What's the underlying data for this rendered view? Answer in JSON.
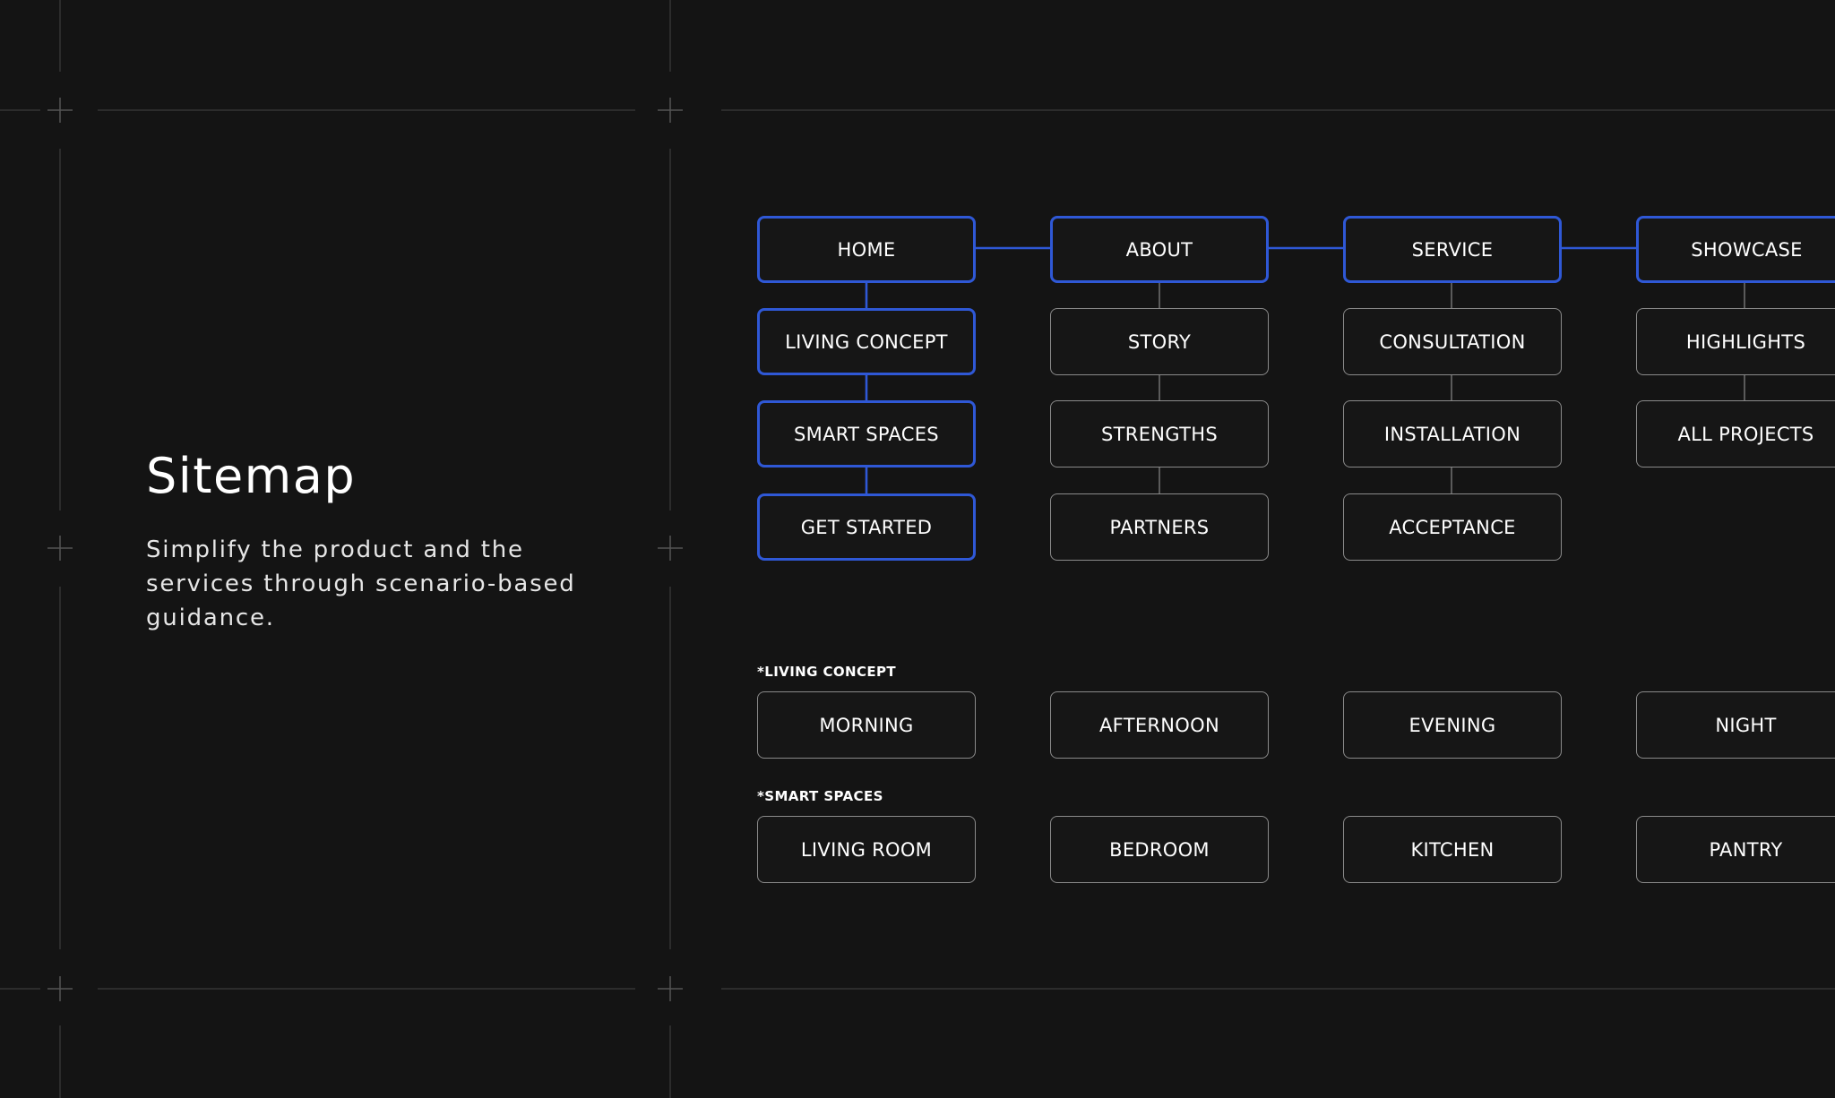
{
  "intro": {
    "title": "Sitemap",
    "description": "Simplify the product and the services through scenario-based guidance."
  },
  "colors": {
    "background": "#141414",
    "highlight": "#2f58d6",
    "node_border": "#8a8a8a",
    "guides": "#3a3a3a"
  },
  "sitemap": {
    "columns": [
      {
        "label": "HOME",
        "highlighted": true,
        "children": [
          {
            "label": "LIVING CONCEPT",
            "highlighted": true
          },
          {
            "label": "SMART SPACES",
            "highlighted": true
          },
          {
            "label": "GET STARTED",
            "highlighted": true
          }
        ]
      },
      {
        "label": "ABOUT",
        "highlighted": true,
        "children": [
          {
            "label": "STORY",
            "highlighted": false
          },
          {
            "label": "STRENGTHS",
            "highlighted": false
          },
          {
            "label": "PARTNERS",
            "highlighted": false
          }
        ]
      },
      {
        "label": "SERVICE",
        "highlighted": true,
        "children": [
          {
            "label": "CONSULTATION",
            "highlighted": false
          },
          {
            "label": "INSTALLATION",
            "highlighted": false
          },
          {
            "label": "ACCEPTANCE",
            "highlighted": false
          }
        ]
      },
      {
        "label": "SHOWCASE",
        "highlighted": true,
        "children": [
          {
            "label": "HIGHLIGHTS",
            "highlighted": false
          },
          {
            "label": "ALL PROJECTS",
            "highlighted": false
          }
        ]
      }
    ]
  },
  "living_concept": {
    "heading": "*LIVING CONCEPT",
    "items": [
      "MORNING",
      "AFTERNOON",
      "EVENING",
      "NIGHT"
    ]
  },
  "smart_spaces": {
    "heading": "*SMART SPACES",
    "items": [
      "LIVING ROOM",
      "BEDROOM",
      "KITCHEN",
      "PANTRY"
    ]
  }
}
